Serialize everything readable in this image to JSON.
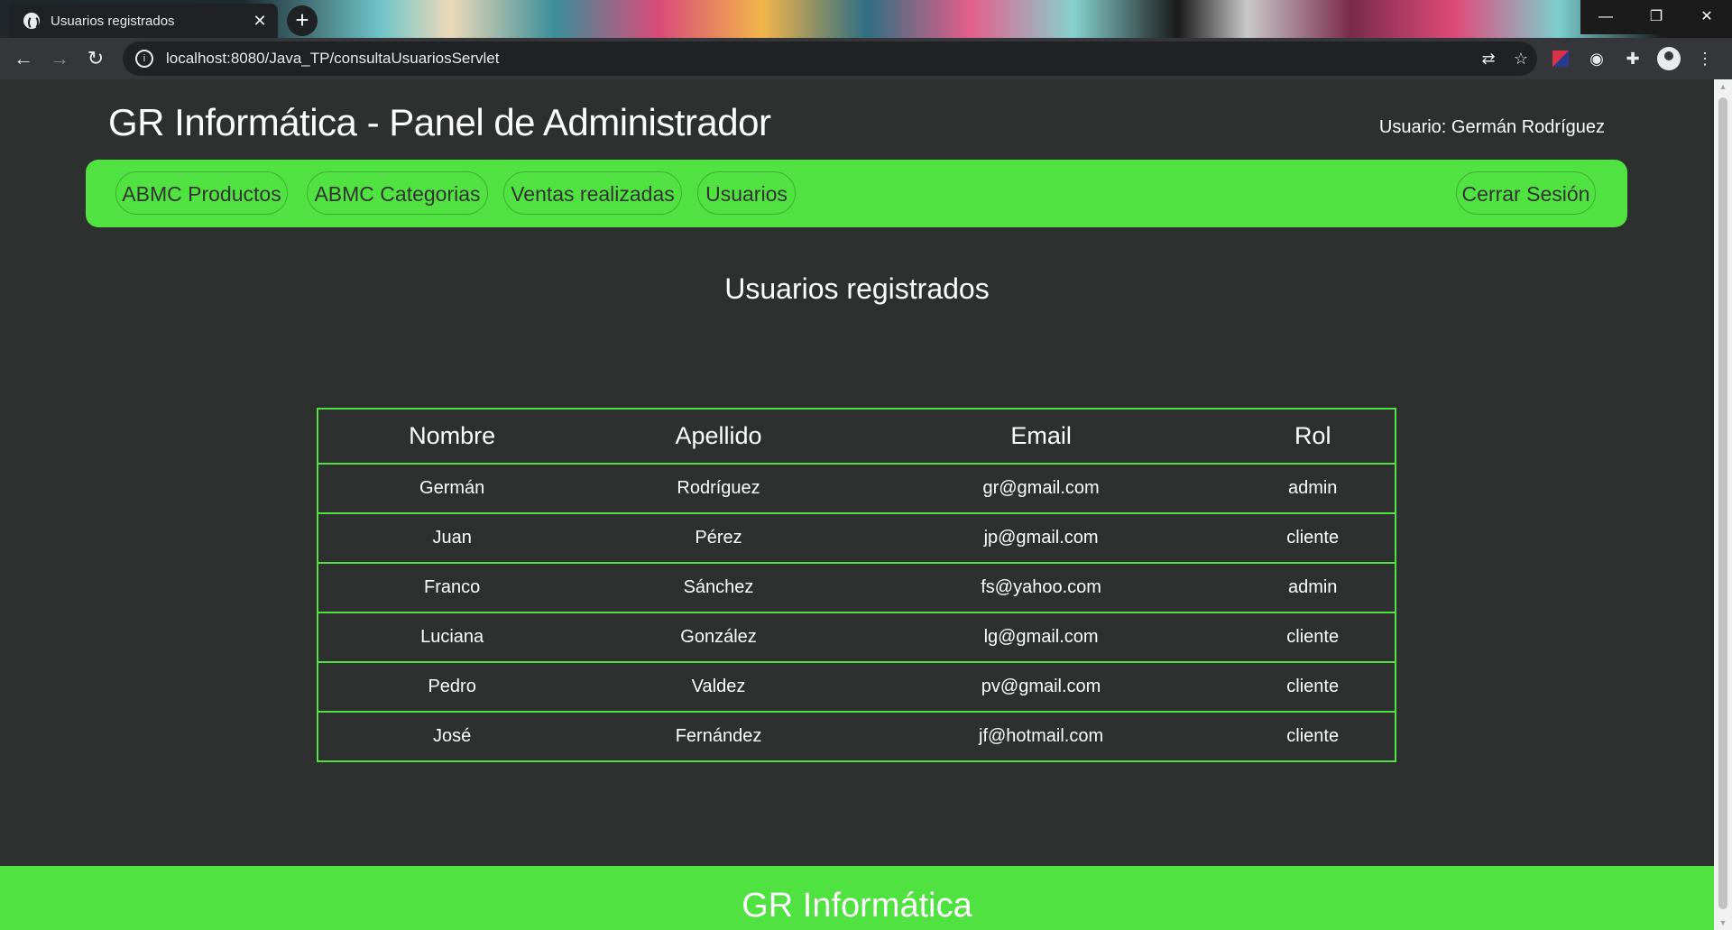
{
  "browser": {
    "tab_title": "Usuarios registrados",
    "tab_close": "✕",
    "new_tab": "+",
    "url": "localhost:8080/Java_TP/consultaUsuariosServlet",
    "window_controls": {
      "minimize": "—",
      "restore": "❐",
      "close": "✕"
    },
    "icons": [
      "back-icon",
      "forward-icon",
      "reload-icon",
      "info-icon",
      "translate-icon",
      "star-icon",
      "extension-icon",
      "puzzle-icon",
      "profile-icon",
      "menu-icon"
    ]
  },
  "header": {
    "title": "GR Informática - Panel de Administrador",
    "user_label": "Usuario: Germán Rodríguez"
  },
  "nav": {
    "items": [
      {
        "label": "ABMC Productos"
      },
      {
        "label": "ABMC Categorias"
      },
      {
        "label": "Ventas realizadas"
      },
      {
        "label": "Usuarios"
      }
    ],
    "logout": "Cerrar Sesión"
  },
  "main": {
    "title": "Usuarios registrados",
    "table": {
      "headers": [
        "Nombre",
        "Apellido",
        "Email",
        "Rol"
      ],
      "rows": [
        [
          "Germán",
          "Rodríguez",
          "gr@gmail.com",
          "admin"
        ],
        [
          "Juan",
          "Pérez",
          "jp@gmail.com",
          "cliente"
        ],
        [
          "Franco",
          "Sánchez",
          "fs@yahoo.com",
          "admin"
        ],
        [
          "Luciana",
          "González",
          "lg@gmail.com",
          "cliente"
        ],
        [
          "Pedro",
          "Valdez",
          "pv@gmail.com",
          "cliente"
        ],
        [
          "José",
          "Fernández",
          "jf@hotmail.com",
          "cliente"
        ]
      ]
    }
  },
  "footer": {
    "title": "GR Informática"
  },
  "colors": {
    "accent": "#4fe240",
    "background": "#2d302e",
    "text": "#ffffff"
  }
}
